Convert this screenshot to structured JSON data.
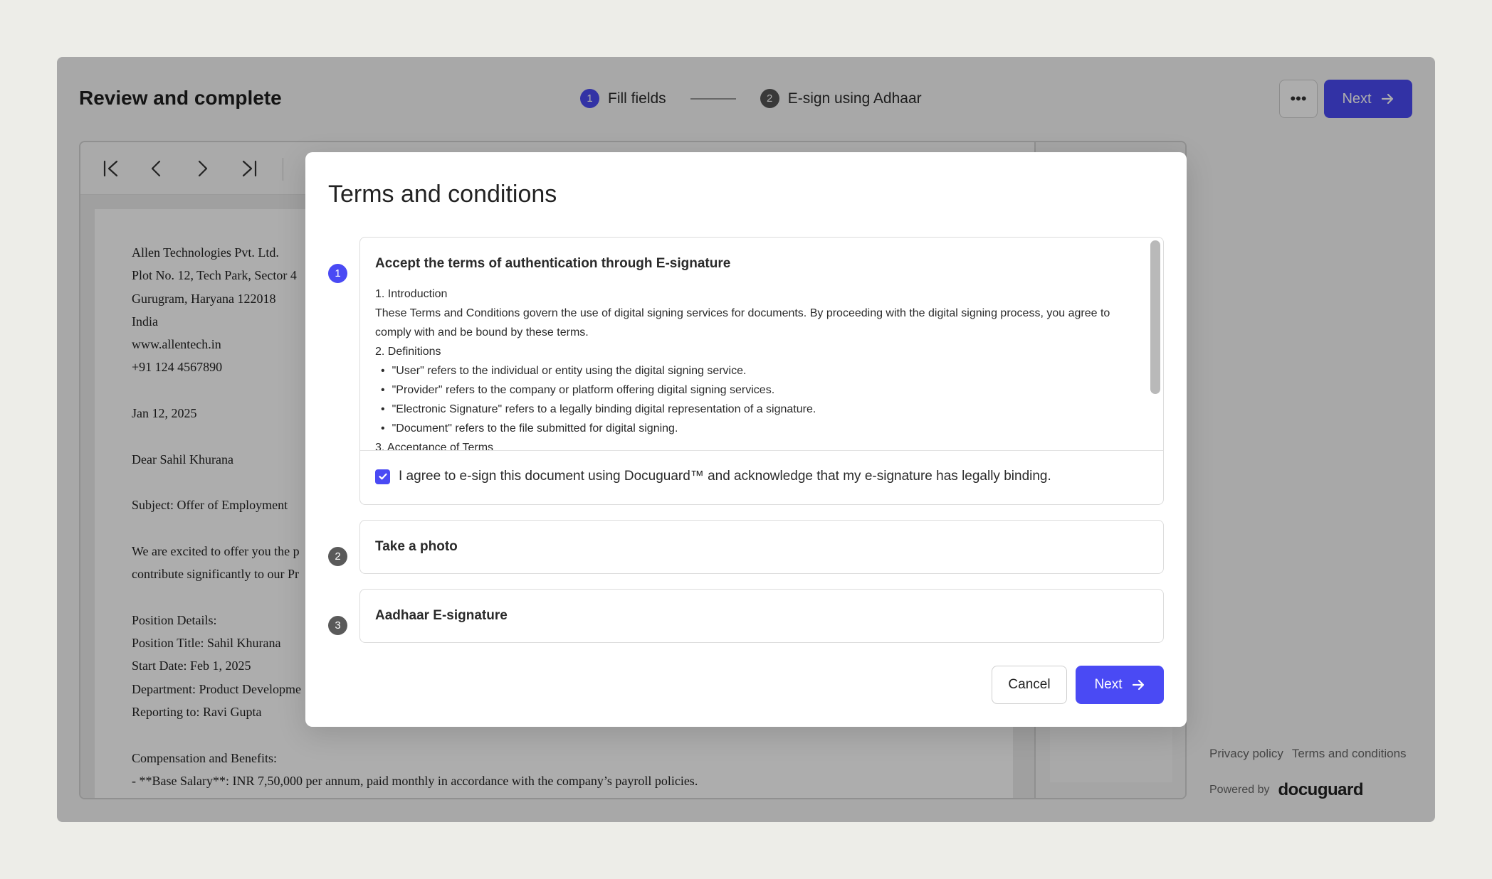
{
  "header": {
    "title": "Review and complete",
    "steps": [
      {
        "num": "1",
        "label": "Fill fields"
      },
      {
        "num": "2",
        "label": "E-sign using Adhaar"
      }
    ],
    "more_label": "•••",
    "next_label": "Next"
  },
  "document": {
    "lines": [
      "Allen Technologies Pvt. Ltd.",
      "Plot No. 12, Tech Park, Sector 4",
      "Gurugram, Haryana 122018",
      "India",
      "www.allentech.in",
      "+91 124 4567890",
      "",
      "Jan 12, 2025",
      "",
      "Dear Sahil Khurana",
      "",
      "Subject: Offer of Employment",
      "",
      "We are excited to offer you the p",
      "contribute significantly to our Pr",
      "",
      "Position Details:",
      "Position Title: Sahil Khurana",
      "Start Date: Feb 1, 2025",
      "Department: Product Developme",
      "Reporting to: Ravi Gupta",
      "",
      "Compensation and Benefits:",
      "- **Base Salary**: INR 7,50,000 per annum, paid monthly in accordance with the company’s payroll policies."
    ]
  },
  "footer": {
    "privacy": "Privacy policy",
    "terms": "Terms and conditions",
    "powered_by": "Powered by",
    "logo_text": "docuguard"
  },
  "modal": {
    "title": "Terms and conditions",
    "steps": [
      {
        "num": "1",
        "title": "Accept the terms of authentication through E-signature"
      },
      {
        "num": "2",
        "title": "Take a photo"
      },
      {
        "num": "3",
        "title": "Aadhaar E-signature"
      }
    ],
    "terms": {
      "intro_heading": "1. Introduction",
      "intro_text": "These Terms and Conditions govern the use of digital signing services for documents. By proceeding with the digital signing process, you agree to comply with and be bound by these terms.",
      "definitions_heading": "2. Definitions",
      "definitions": [
        "\"User\" refers to the individual or entity using the digital signing service.",
        "\"Provider\" refers to the company or platform offering digital signing services.",
        "\"Electronic Signature\" refers to a legally binding digital representation of a signature.",
        "\"Document\" refers to the file submitted for digital signing."
      ],
      "acceptance_heading": "3. Acceptance of Terms"
    },
    "agree_text": "I agree to e-sign this document using Docuguard™ and acknowledge that my e-signature has legally binding.",
    "agree_checked": true,
    "cancel_label": "Cancel",
    "next_label": "Next"
  },
  "colors": {
    "accent": "#4a4af4",
    "backdrop": "#edede8"
  }
}
